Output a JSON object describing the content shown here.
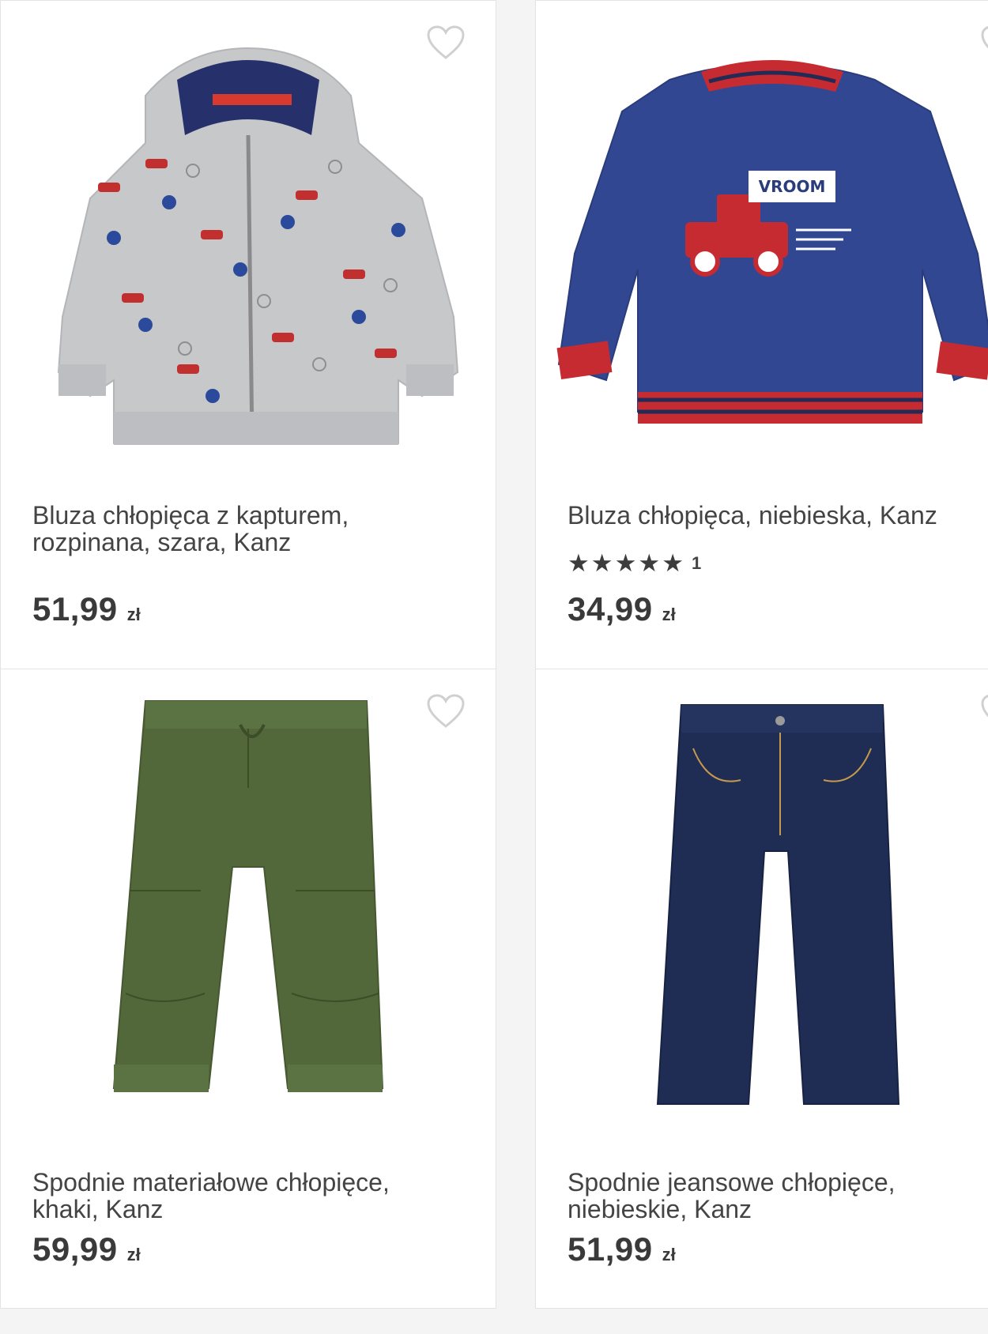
{
  "colors": {
    "background": "#f4f4f4",
    "card": "#ffffff",
    "heart_outline": "#d0d0d0",
    "text": "#444444"
  },
  "products": [
    {
      "title_line1": "Bluza chłopięca z kapturem,",
      "title_line2": "rozpinana, szara, Kanz",
      "price": "51,99",
      "currency": "zł",
      "favorite_icon": "heart-outline-icon",
      "image_desc": "grey zip hoodie with car print"
    },
    {
      "title_line1": "Bluza chłopięca, niebieska, Kanz",
      "title_line2": "",
      "rating_stars": 5,
      "rating_count": "1",
      "price": "34,99",
      "currency": "zł",
      "favorite_icon": "heart-outline-icon",
      "image_desc": "navy sweatshirt with red truck"
    },
    {
      "title_line1": "Spodnie materiałowe chłopięce,",
      "title_line2": "khaki, Kanz",
      "price": "59,99",
      "currency": "zł",
      "favorite_icon": "heart-outline-icon",
      "image_desc": "khaki jogger trousers"
    },
    {
      "title_line1": "Spodnie jeansowe chłopięce,",
      "title_line2": "niebieskie, Kanz",
      "price": "51,99",
      "currency": "zł",
      "favorite_icon": "heart-outline-icon",
      "image_desc": "dark blue jeans"
    }
  ]
}
